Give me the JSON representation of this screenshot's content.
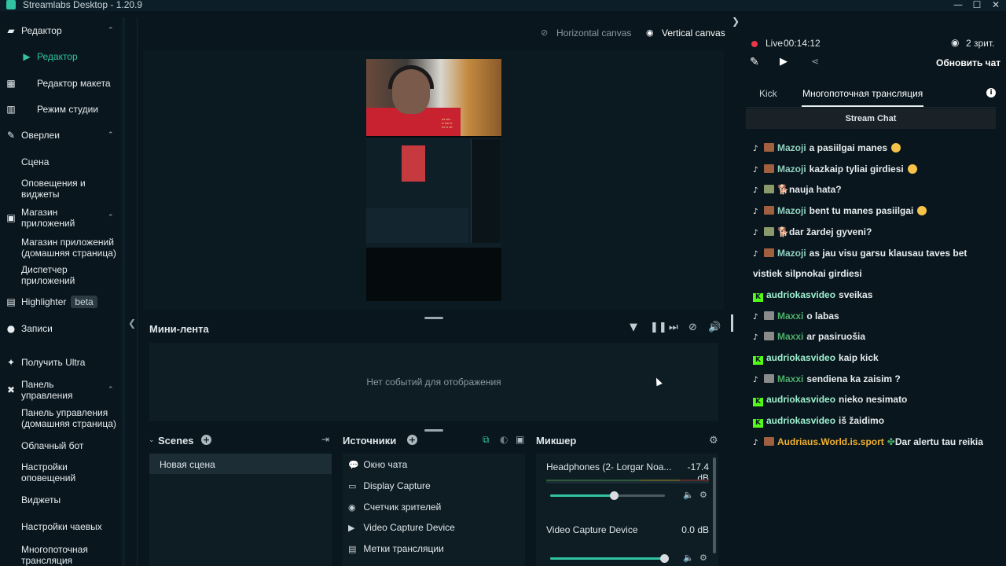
{
  "window": {
    "title": "Streamlabs Desktop - 1.20.9"
  },
  "colors": {
    "accent": "#31c3a2",
    "background": "#09161d",
    "live": "#e8384a",
    "kick": "#53fc18"
  },
  "sidebar": {
    "items": [
      {
        "label": "Редактор",
        "icon": "editor-icon",
        "section": true,
        "caret": "chevron-up-icon"
      },
      {
        "label": "Редактор",
        "icon": "camera-icon",
        "active": true
      },
      {
        "label": "Редактор макета",
        "icon": "layout-icon"
      },
      {
        "label": "Режим студии",
        "icon": "studio-mode-icon"
      },
      {
        "label": "Оверлеи",
        "icon": "overlays-icon",
        "section": true,
        "caret": "chevron-up-icon"
      },
      {
        "label": "Сцена"
      },
      {
        "label": "Оповещения и виджеты"
      },
      {
        "label": "Магазин приложений",
        "icon": "store-icon",
        "section": true,
        "caret": "chevron-up-icon"
      },
      {
        "label": "Магазин приложений (домашняя страница)"
      },
      {
        "label": "Диспетчер приложений"
      },
      {
        "label": "Highlighter",
        "icon": "highlighter-icon",
        "badge": "beta"
      },
      {
        "label": "Записи",
        "icon": "recordings-icon"
      },
      {
        "label": "Получить Ultra",
        "icon": "ultra-icon"
      },
      {
        "label": "Панель управления",
        "icon": "dashboard-icon",
        "section": true,
        "caret": "chevron-up-icon"
      },
      {
        "label": "Панель управления (домашняя страница)"
      },
      {
        "label": "Облачный бот"
      },
      {
        "label": "Настройки оповещений"
      },
      {
        "label": "Виджеты"
      },
      {
        "label": "Настройки чаевых"
      },
      {
        "label": "Многопоточная трансляция"
      }
    ]
  },
  "canvas": {
    "horizontal": "Horizontal canvas",
    "vertical": "Vertical canvas"
  },
  "minifeed": {
    "title": "Мини-лента",
    "empty": "Нет событий для отображения"
  },
  "scenes": {
    "title": "Scenes",
    "items": [
      "Новая сцена"
    ]
  },
  "sources": {
    "title": "Источники",
    "items": [
      {
        "label": "Окно чата",
        "icon": "chat-icon"
      },
      {
        "label": "Display Capture",
        "icon": "monitor-icon"
      },
      {
        "label": "Счетчик зрителей",
        "icon": "eye-icon"
      },
      {
        "label": "Video Capture Device",
        "icon": "video-camera-icon"
      },
      {
        "label": "Метки трансляции",
        "icon": "document-icon"
      }
    ]
  },
  "mixer": {
    "title": "Микшер",
    "channels": [
      {
        "name": "Headphones (2- Lorgar Noa...",
        "db": "-17.4 dB",
        "level": 0.56
      },
      {
        "name": "Video Capture Device",
        "db": "0.0 dB",
        "level": 1.0
      }
    ]
  },
  "stream": {
    "live_label": "Live",
    "time": "00:14:12",
    "viewers": "2 зрит.",
    "refresh_chat": "Обновить чат"
  },
  "tabs": [
    "Kick",
    "Многопоточная трансляция"
  ],
  "chat": {
    "header": "Stream Chat",
    "messages": [
      {
        "platform": "tiktok",
        "user": "Mazoji",
        "color": "#8fd0c0",
        "text": "a pasiilgai manes",
        "emoji": true
      },
      {
        "platform": "tiktok",
        "user": "Mazoji",
        "color": "#8fd0c0",
        "text": "kazkaip tyliai girdiesi",
        "emoji": true
      },
      {
        "platform": "tiktok",
        "user": "",
        "color": "#e6ecef",
        "text": "nauja hata?",
        "dog": true,
        "avatar": "#8a9a6a"
      },
      {
        "platform": "tiktok",
        "user": "Mazoji",
        "color": "#8fd0c0",
        "text": "bent tu manes pasiilgai",
        "emoji": true
      },
      {
        "platform": "tiktok",
        "user": "",
        "color": "#e6ecef",
        "text": "dar žardej gyveni?",
        "dog": true,
        "avatar": "#8a9a6a"
      },
      {
        "platform": "tiktok",
        "user": "Mazoji",
        "color": "#8fd0c0",
        "text": "as jau visu garsu klausau taves bet vistiek silpnokai girdiesi"
      },
      {
        "platform": "kick",
        "user": "audriokasvideo",
        "color": "#9ef0d0",
        "text": "sveikas"
      },
      {
        "platform": "tiktok",
        "user": "Maxxi",
        "color": "#4caf6a",
        "text": "o labas"
      },
      {
        "platform": "tiktok",
        "user": "Maxxi",
        "color": "#4caf6a",
        "text": "ar pasiruošia"
      },
      {
        "platform": "kick",
        "user": "audriokasvideo",
        "color": "#9ef0d0",
        "text": "kaip kick"
      },
      {
        "platform": "tiktok",
        "user": "Maxxi",
        "color": "#4caf6a",
        "text": "sendiena ka zaisim ?"
      },
      {
        "platform": "kick",
        "user": "audriokasvideo",
        "color": "#9ef0d0",
        "text": "nieko nesimato"
      },
      {
        "platform": "kick",
        "user": "audriokasvideo",
        "color": "#9ef0d0",
        "text": "iš žaidimo"
      },
      {
        "platform": "tiktok",
        "user": "Audriaus.World.is.sport",
        "color": "#f0b030",
        "text": "Dar alertu tau reikia",
        "clover": true
      }
    ]
  }
}
